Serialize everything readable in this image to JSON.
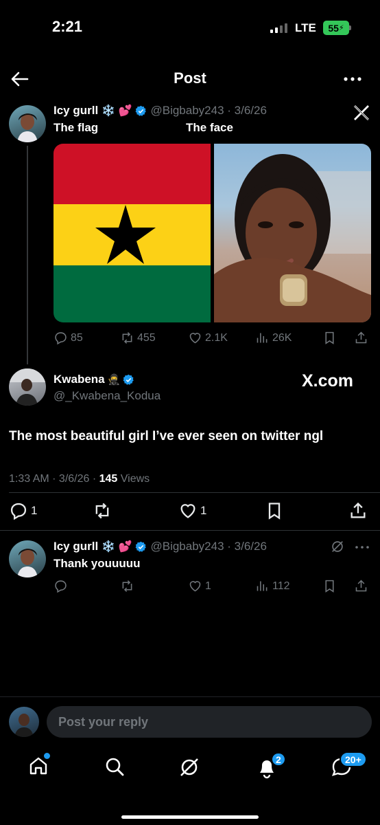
{
  "status_bar": {
    "time": "2:21",
    "network": "LTE",
    "battery": "55"
  },
  "header": {
    "title": "Post"
  },
  "quoted_post": {
    "name": "Icy gurll",
    "emoji": "❄️ 💕",
    "handle": "@Bigbaby243 · 3/6/26",
    "caption_left": "The flag",
    "caption_right": "The face",
    "flag_colors": {
      "red": "#ce1126",
      "yellow": "#fcd116",
      "green": "#006b3f",
      "star": "#000000"
    },
    "replies": "85",
    "reposts": "455",
    "likes": "2.1K",
    "views": "26K"
  },
  "main_post": {
    "name": "Kwabena",
    "emoji": "🥷",
    "handle": "@_Kwabena_Kodua",
    "watermark": "X.com",
    "text": "The most beautiful girl I’ve ever seen on twitter ngl",
    "meta_time": "1:33 AM · 3/6/26 · ",
    "meta_views_count": "145",
    "meta_views_label": " Views",
    "replies": "1",
    "likes": "1"
  },
  "reply_post": {
    "name": "Icy gurll",
    "emoji": "❄️ 💕",
    "handle": "@Bigbaby243 · 3/6/26",
    "text": "Thank youuuuu",
    "likes": "1",
    "views": "112"
  },
  "composer": {
    "placeholder": "Post your reply"
  },
  "tab_bar": {
    "notifications_badge": "2",
    "messages_badge": "20+"
  },
  "colors": {
    "accent": "#1d9bf0",
    "muted": "#71767b",
    "battery": "#34c759"
  }
}
